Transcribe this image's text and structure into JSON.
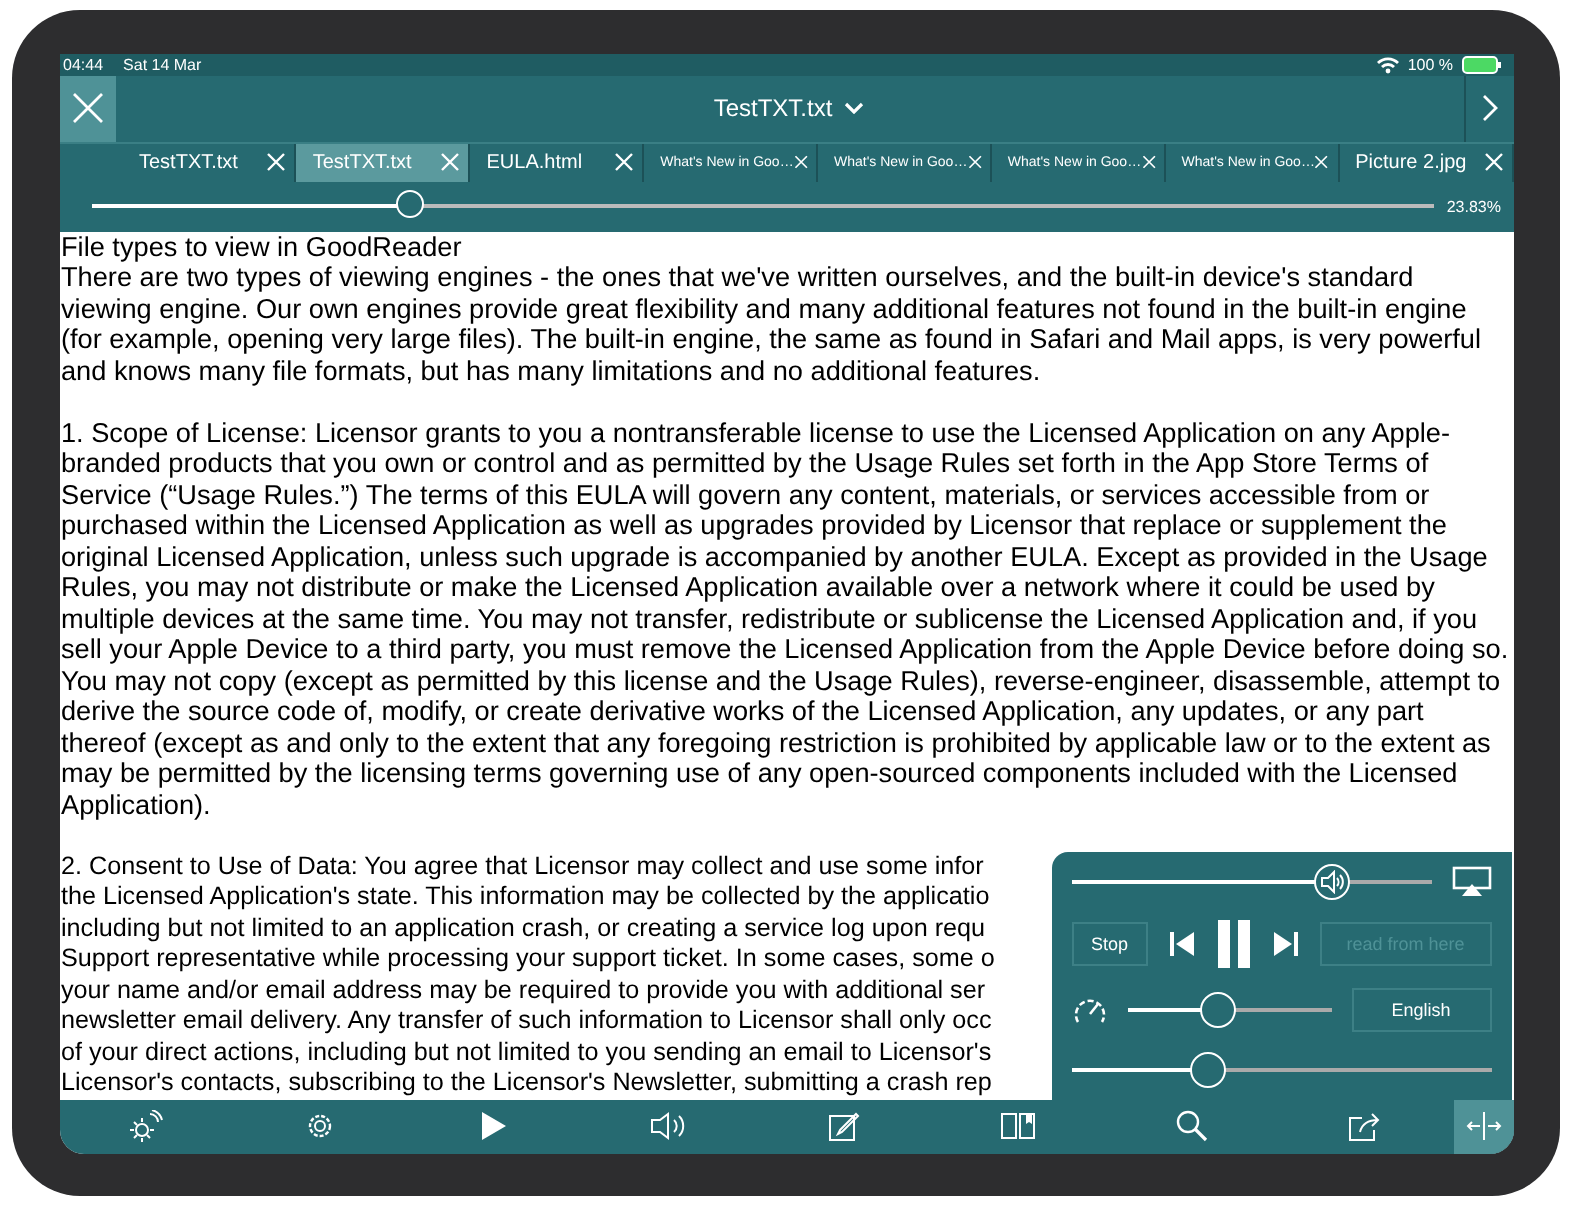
{
  "status_bar": {
    "time": "04:44",
    "date": "Sat 14 Mar",
    "battery": "100 %"
  },
  "title_bar": {
    "title": "TestTXT.txt"
  },
  "tabs": [
    {
      "label": "TestTXT.txt",
      "selected": false,
      "kind": "normal"
    },
    {
      "label": "TestTXT.txt",
      "selected": true,
      "kind": "normal"
    },
    {
      "label": "EULA.html",
      "selected": false,
      "kind": "normal"
    },
    {
      "label": "What's New in Goo…",
      "selected": false,
      "kind": "small"
    },
    {
      "label": "What's New in Goo…",
      "selected": false,
      "kind": "small"
    },
    {
      "label": "What's New in Goo…",
      "selected": false,
      "kind": "small"
    },
    {
      "label": "What's New in Goo…",
      "selected": false,
      "kind": "small"
    },
    {
      "label": "Picture 2.jpg",
      "selected": false,
      "kind": "normal"
    }
  ],
  "position_slider": {
    "level": 0.2383,
    "reading": "23.83%"
  },
  "document": {
    "heading": "File types to view in GoodReader",
    "paragraphs": [
      "There are two types of viewing engines - the ones that we've written ourselves, and the built-in device's standard viewing engine. Our own engines provide great flexibility and many additional features not found in the built-in engine (for example, opening very large files). The built-in engine, the same as found in Safari and Mail apps, is very powerful and knows many file formats, but has many limitations and no additional features.",
      "1. Scope of License: Licensor grants to you a nontransferable license to use the Licensed Application on any Apple-branded products that you own or control and as permitted by the Usage Rules set forth in the App Store Terms of Service (“Usage Rules.”) The terms of this EULA will govern any content, materials, or services accessible from or purchased within the Licensed Application as well as upgrades provided by Licensor that replace or supplement the original Licensed Application, unless such upgrade is accompanied by another EULA. Except as provided in the Usage Rules, you may not distribute or make the Licensed Application available over a network where it could be used by multiple devices at the same time. You may not transfer, redistribute or sublicense the Licensed Application and, if you sell your Apple Device to a third party, you must remove the Licensed Application from the Apple Device before doing so. You may not copy (except as permitted by this license and the Usage Rules), reverse-engineer, disassemble, attempt to derive the source code of, modify, or create derivative works of the Licensed Application, any updates, or any part thereof (except as and only to the extent that any foregoing restriction is prohibited by applicable law or to the extent as may be permitted by the licensing terms governing use of any open-sourced components included with the Licensed Application)."
    ],
    "partial_lines": [
      "2. Consent to Use of Data: You agree that Licensor may collect and use some infor",
      "the Licensed Application's state. This information may be collected by the applicatio",
      "including but not limited to an application crash, or creating a service log upon requ",
      "Support representative while processing your support ticket. In some cases, some o",
      "your name and/or email address may be required to provide you with additional ser",
      "newsletter email delivery. Any transfer of such information to Licensor shall only occ",
      "of your direct actions, including but not limited to you sending an email to Licensor's",
      "Licensor's contacts, subscribing to the Licensor's Newsletter, submitting a crash rep"
    ]
  },
  "speech_panel": {
    "volume": {
      "level": 0.73
    },
    "stop": "Stop",
    "read_from_here": {
      "label": "read from here",
      "disabled": true
    },
    "speed": {
      "level": 0.46
    },
    "language": "English",
    "pitch": {
      "level": 0.33
    }
  },
  "toolbar": [
    {
      "kind": "brightness"
    },
    {
      "kind": "settings"
    },
    {
      "kind": "play"
    },
    {
      "kind": "speaker"
    },
    {
      "kind": "edit"
    },
    {
      "kind": "book"
    },
    {
      "kind": "search"
    },
    {
      "kind": "share"
    },
    {
      "kind": "resize",
      "selected": true
    }
  ]
}
